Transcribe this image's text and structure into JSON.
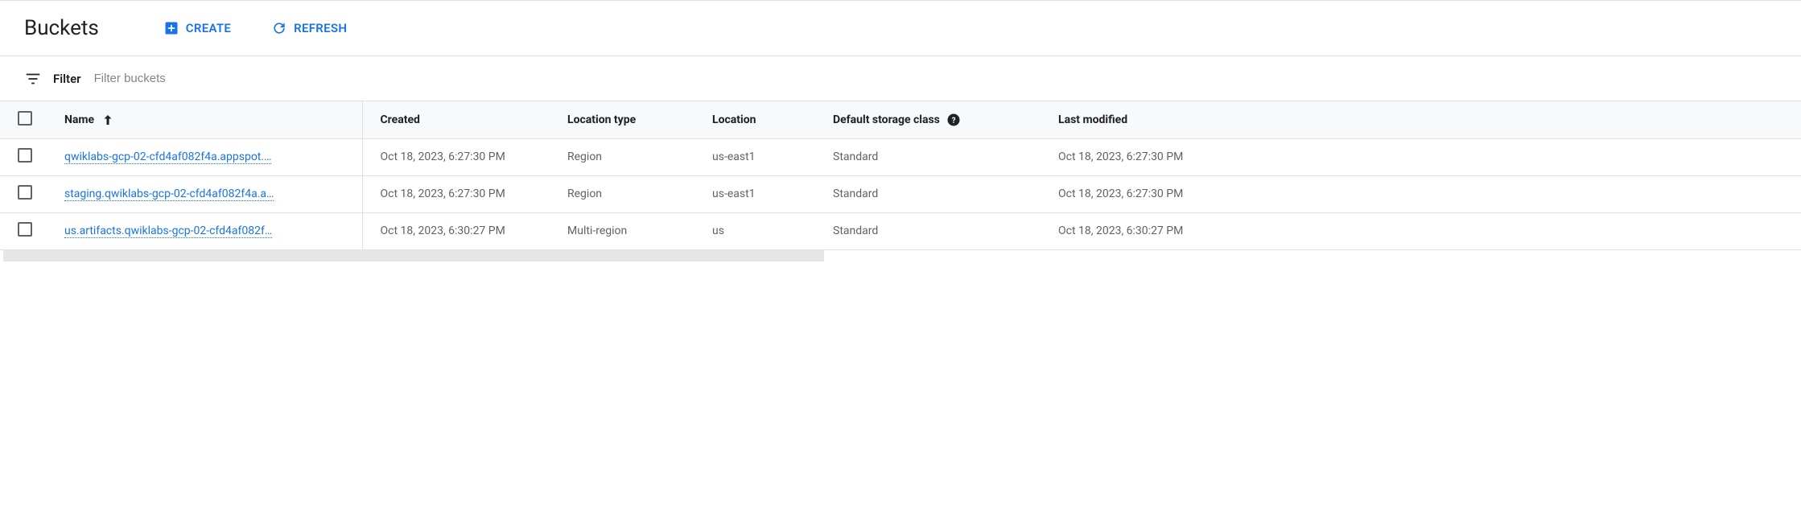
{
  "header": {
    "title": "Buckets",
    "create_label": "CREATE",
    "refresh_label": "REFRESH"
  },
  "filter": {
    "label": "Filter",
    "placeholder": "Filter buckets"
  },
  "columns": {
    "name": "Name",
    "created": "Created",
    "location_type": "Location type",
    "location": "Location",
    "storage_class": "Default storage class",
    "last_modified": "Last modified"
  },
  "rows": [
    {
      "name": "qwiklabs-gcp-02-cfd4af082f4a.appspot.…",
      "created": "Oct 18, 2023, 6:27:30 PM",
      "location_type": "Region",
      "location": "us-east1",
      "storage_class": "Standard",
      "last_modified": "Oct 18, 2023, 6:27:30 PM"
    },
    {
      "name": "staging.qwiklabs-gcp-02-cfd4af082f4a.a…",
      "created": "Oct 18, 2023, 6:27:30 PM",
      "location_type": "Region",
      "location": "us-east1",
      "storage_class": "Standard",
      "last_modified": "Oct 18, 2023, 6:27:30 PM"
    },
    {
      "name": "us.artifacts.qwiklabs-gcp-02-cfd4af082f…",
      "created": "Oct 18, 2023, 6:30:27 PM",
      "location_type": "Multi-region",
      "location": "us",
      "storage_class": "Standard",
      "last_modified": "Oct 18, 2023, 6:30:27 PM"
    }
  ]
}
